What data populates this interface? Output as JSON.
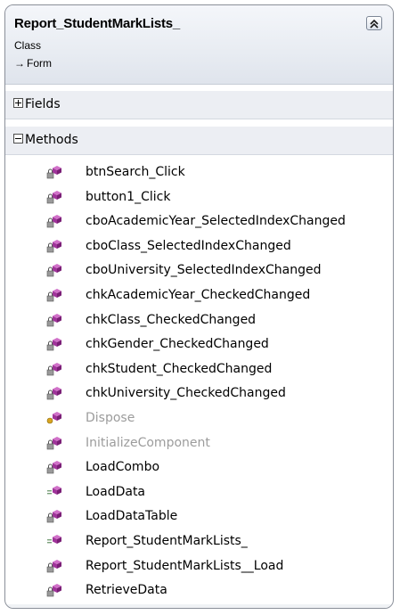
{
  "class_box": {
    "title": "Report_StudentMarkLists_",
    "kind": "Class",
    "base_type": "Form",
    "base_arrow": "→"
  },
  "sections": {
    "fields": {
      "label": "Fields",
      "expanded": false
    },
    "methods": {
      "label": "Methods",
      "expanded": true
    }
  },
  "methods": [
    {
      "name": "btnSearch_Click",
      "icon": "private-method-icon",
      "disabled": false
    },
    {
      "name": "button1_Click",
      "icon": "private-method-icon",
      "disabled": false
    },
    {
      "name": "cboAcademicYear_SelectedIndexChanged",
      "icon": "private-method-icon",
      "disabled": false
    },
    {
      "name": "cboClass_SelectedIndexChanged",
      "icon": "private-method-icon",
      "disabled": false
    },
    {
      "name": "cboUniversity_SelectedIndexChanged",
      "icon": "private-method-icon",
      "disabled": false
    },
    {
      "name": "chkAcademicYear_CheckedChanged",
      "icon": "private-method-icon",
      "disabled": false
    },
    {
      "name": "chkClass_CheckedChanged",
      "icon": "private-method-icon",
      "disabled": false
    },
    {
      "name": "chkGender_CheckedChanged",
      "icon": "private-method-icon",
      "disabled": false
    },
    {
      "name": "chkStudent_CheckedChanged",
      "icon": "private-method-icon",
      "disabled": false
    },
    {
      "name": "chkUniversity_CheckedChanged",
      "icon": "private-method-icon",
      "disabled": false
    },
    {
      "name": "Dispose",
      "icon": "protected-method-icon",
      "disabled": true
    },
    {
      "name": "InitializeComponent",
      "icon": "private-method-icon",
      "disabled": true
    },
    {
      "name": "LoadCombo",
      "icon": "private-method-icon",
      "disabled": false
    },
    {
      "name": "LoadData",
      "icon": "public-method-icon",
      "disabled": false
    },
    {
      "name": "LoadDataTable",
      "icon": "private-method-icon",
      "disabled": false
    },
    {
      "name": "Report_StudentMarkLists_",
      "icon": "public-method-icon",
      "disabled": false
    },
    {
      "name": "Report_StudentMarkLists__Load",
      "icon": "private-method-icon",
      "disabled": false
    },
    {
      "name": "RetrieveData",
      "icon": "private-method-icon",
      "disabled": false
    }
  ],
  "colors": {
    "method_cube": "#a0349a",
    "lock": "#9a9a9a",
    "protected_key": "#d9a520",
    "disabled_text": "#9c9c9c"
  }
}
